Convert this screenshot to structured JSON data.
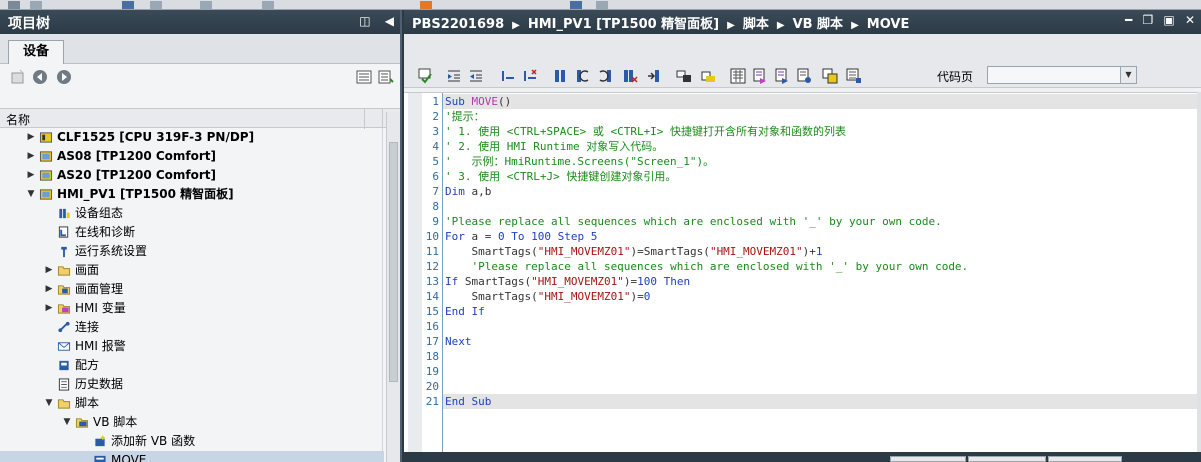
{
  "project_tree": {
    "title": "项目树",
    "tab_label": "设备",
    "column_header": "名称",
    "items": [
      {
        "label": "CLF1525 [CPU 319F-3 PN/DP]",
        "level": 1,
        "expand": "right",
        "icon": "plc-icon",
        "bold": true
      },
      {
        "label": "AS08 [TP1200 Comfort]",
        "level": 1,
        "expand": "right",
        "icon": "hmi-panel-icon",
        "bold": true
      },
      {
        "label": "AS20 [TP1200 Comfort]",
        "level": 1,
        "expand": "right",
        "icon": "hmi-panel-icon",
        "bold": true
      },
      {
        "label": "HMI_PV1 [TP1500 精智面板]",
        "level": 1,
        "expand": "down",
        "icon": "hmi-panel-icon",
        "bold": true
      },
      {
        "label": "设备组态",
        "level": 2,
        "expand": "none",
        "icon": "device-config-icon",
        "bold": false
      },
      {
        "label": "在线和诊断",
        "level": 2,
        "expand": "none",
        "icon": "diagnostics-icon",
        "bold": false
      },
      {
        "label": "运行系统设置",
        "level": 2,
        "expand": "none",
        "icon": "runtime-settings-icon",
        "bold": false
      },
      {
        "label": "画面",
        "level": 2,
        "expand": "right",
        "icon": "folder-icon",
        "bold": false
      },
      {
        "label": "画面管理",
        "level": 2,
        "expand": "right",
        "icon": "screen-management-icon",
        "bold": false
      },
      {
        "label": "HMI 变量",
        "level": 2,
        "expand": "right",
        "icon": "hmi-tags-icon",
        "bold": false
      },
      {
        "label": "连接",
        "level": 2,
        "expand": "none",
        "icon": "connection-icon",
        "bold": false
      },
      {
        "label": "HMI 报警",
        "level": 2,
        "expand": "none",
        "icon": "alarm-icon",
        "bold": false
      },
      {
        "label": "配方",
        "level": 2,
        "expand": "none",
        "icon": "recipe-icon",
        "bold": false
      },
      {
        "label": "历史数据",
        "level": 2,
        "expand": "none",
        "icon": "history-icon",
        "bold": false
      },
      {
        "label": "脚本",
        "level": 2,
        "expand": "down",
        "icon": "folder-icon",
        "bold": false
      },
      {
        "label": "VB 脚本",
        "level": 3,
        "expand": "down",
        "icon": "vb-folder-icon",
        "bold": false
      },
      {
        "label": "添加新 VB 函数",
        "level": 4,
        "expand": "none",
        "icon": "add-function-icon",
        "bold": false
      },
      {
        "label": "MOVE",
        "level": 4,
        "expand": "none",
        "icon": "vb-script-icon",
        "bold": false,
        "selected": true
      }
    ]
  },
  "editor": {
    "breadcrumb": [
      "PBS2201698",
      "HMI_PV1 [TP1500 精智面板]",
      "脚本",
      "VB 脚本",
      "MOVE"
    ],
    "code_page_label": "代码页",
    "code_page_value": "",
    "lines": [
      {
        "n": "1",
        "text": "Sub MOVE()"
      },
      {
        "n": "2",
        "text": "'提示："
      },
      {
        "n": "3",
        "text": "' 1. 使用 <CTRL+SPACE> 或 <CTRL+I> 快捷键打开含所有对象和函数的列表"
      },
      {
        "n": "4",
        "text": "' 2. 使用 HMI Runtime 对象写入代码。"
      },
      {
        "n": "5",
        "text": "'   示例：HmiRuntime.Screens(\"Screen_1\")。"
      },
      {
        "n": "6",
        "text": "' 3. 使用 <CTRL+J> 快捷键创建对象引用。"
      },
      {
        "n": "7",
        "text": "Dim a,b"
      },
      {
        "n": "8",
        "text": ""
      },
      {
        "n": "9",
        "text": "'Please replace all sequences which are enclosed with '_' by your own code."
      },
      {
        "n": "10",
        "text": "For a = 0 To 100 Step 5"
      },
      {
        "n": "11",
        "text": "    SmartTags(\"HMI_MOVEMZ01\")=SmartTags(\"HMI_MOVEMZ01\")+1"
      },
      {
        "n": "12",
        "text": "    'Please replace all sequences which are enclosed with '_' by your own code."
      },
      {
        "n": "13",
        "text": "If SmartTags(\"HMI_MOVEMZ01\")=100 Then"
      },
      {
        "n": "14",
        "text": "    SmartTags(\"HMI_MOVEMZ01\")=0"
      },
      {
        "n": "15",
        "text": "End If"
      },
      {
        "n": "16",
        "text": ""
      },
      {
        "n": "17",
        "text": "Next"
      },
      {
        "n": "18",
        "text": ""
      },
      {
        "n": "19",
        "text": ""
      },
      {
        "n": "20",
        "text": ""
      },
      {
        "n": "21",
        "text": "End Sub"
      }
    ]
  },
  "colors": {
    "title_bar": "#2c3a46",
    "keyword": "#1f3fbf",
    "comment": "#1a8a1a",
    "function_name": "#b03bb0",
    "string": "#a31515",
    "highlight_line": "#e4e4e4"
  }
}
